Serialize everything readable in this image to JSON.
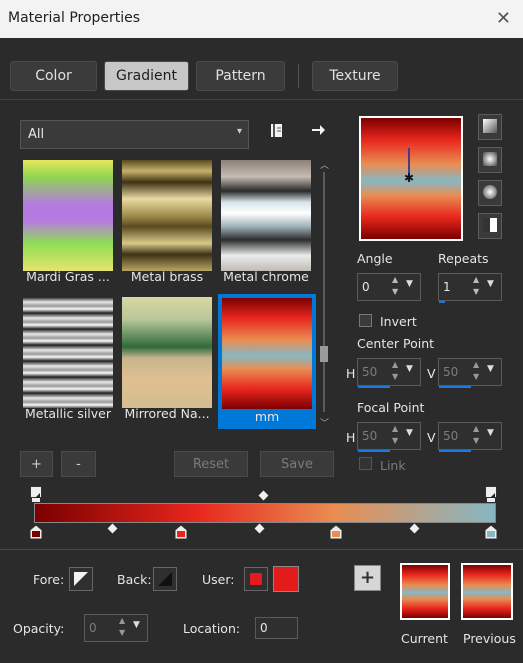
{
  "window": {
    "title": "Material Properties"
  },
  "tabs": [
    {
      "label": "Color"
    },
    {
      "label": "Gradient"
    },
    {
      "label": "Pattern"
    },
    {
      "label": "Texture"
    }
  ],
  "library": {
    "category": "All",
    "items": [
      {
        "label": "Mardi Gras ..."
      },
      {
        "label": "Metal brass"
      },
      {
        "label": "Metal chrome"
      },
      {
        "label": "Metallic silver"
      },
      {
        "label": "Mirrored Na..."
      },
      {
        "label": "mm"
      }
    ],
    "add_label": "+",
    "remove_label": "-",
    "reset_label": "Reset",
    "save_label": "Save"
  },
  "settings": {
    "angle_label": "Angle",
    "angle_value": "0",
    "repeats_label": "Repeats",
    "repeats_value": "1",
    "invert_label": "Invert",
    "center_label": "Center Point",
    "center_h_label": "H",
    "center_h": "50",
    "center_v_label": "V",
    "center_v": "50",
    "focal_label": "Focal Point",
    "focal_h_label": "H",
    "focal_h": "50",
    "focal_v_label": "V",
    "focal_v": "50",
    "link_label": "Link"
  },
  "bottom": {
    "fore_label": "Fore:",
    "back_label": "Back:",
    "user_label": "User:",
    "opacity_label": "Opacity:",
    "opacity_value": "0",
    "location_label": "Location:",
    "location_value": "0",
    "current_label": "Current",
    "previous_label": "Previous",
    "add_label": "+"
  },
  "colors": {
    "accent": "#0078d7",
    "user_color": "#e31b1b",
    "gradient_stop_1": "#7a0000",
    "gradient_stop_2": "#e8261d",
    "gradient_stop_3": "#e98d52",
    "gradient_stop_4": "#86b7c4"
  }
}
